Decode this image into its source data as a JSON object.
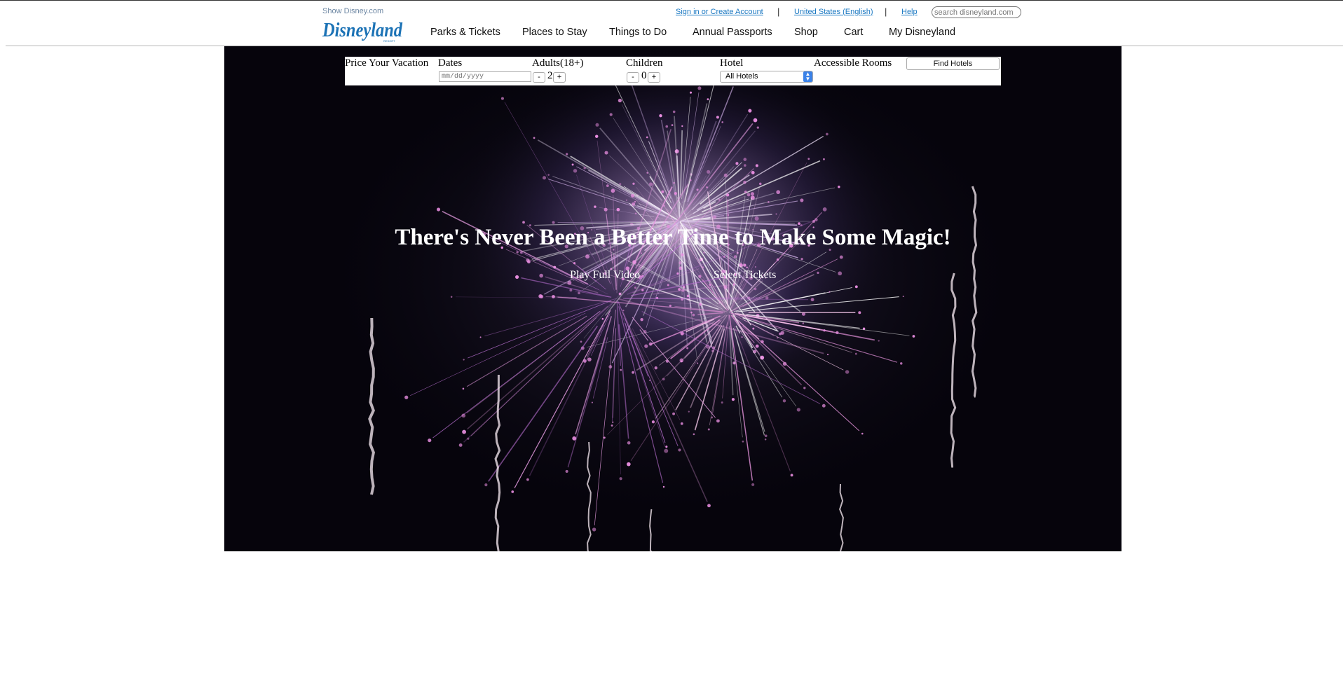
{
  "header": {
    "show_disney": "Show Disney.com",
    "logo_text": "Disneyland",
    "logo_sub": "RESORT",
    "top_links": {
      "sign_in": "Sign in or Create Account",
      "region": "United States (English)",
      "help": "Help",
      "separator": "|"
    },
    "search_placeholder": "search disneyland.com",
    "nav": [
      "Parks & Tickets",
      "Places to Stay",
      "Things to Do",
      "Annual Passports",
      "Shop",
      "Cart",
      "My Disneyland"
    ]
  },
  "booking": {
    "title": "Price Your Vacation",
    "dates_label": "Dates",
    "dates_placeholder": "mm/dd/yyyy",
    "adults_label": "Adults(18+)",
    "adults_value": "2",
    "children_label": "Children",
    "children_value": "0",
    "minus": "-",
    "plus": "+",
    "hotel_label": "Hotel",
    "hotel_selected": "All Hotels",
    "accessible_label": "Accessible Rooms",
    "find_button": "Find Hotels"
  },
  "hero": {
    "headline": "There's Never Been a Better Time to Make Some Magic!",
    "play_video": "Play Full Video",
    "select_tickets": "Select Tickets"
  },
  "colors": {
    "link_blue": "#1a78c2",
    "logo_blue": "#1b72b5",
    "hero_background": "#06040c",
    "select_arrow": "#3b82e8"
  }
}
